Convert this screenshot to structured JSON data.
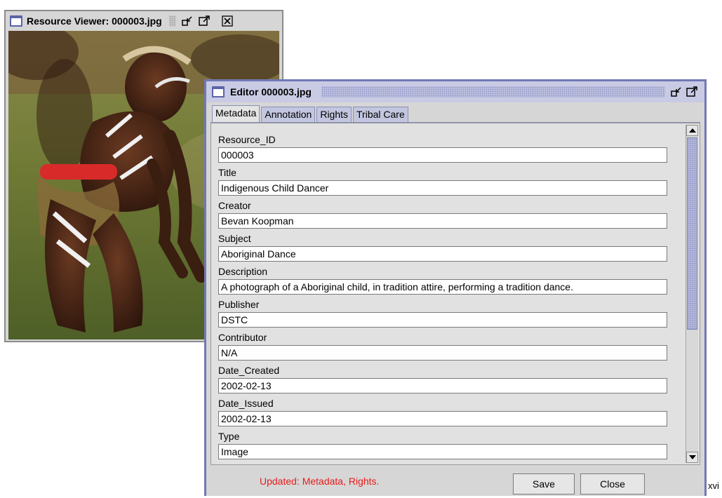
{
  "viewer": {
    "title": "Resource Viewer: 000003.jpg",
    "photo_alt": "Indigenous child dancer photograph"
  },
  "editor": {
    "title": "Editor 000003.jpg",
    "tabs": [
      "Metadata",
      "Annotation",
      "Rights",
      "Tribal Care"
    ],
    "active_tab": "Metadata",
    "fields": [
      {
        "label": "Resource_ID",
        "value": "000003"
      },
      {
        "label": "Title",
        "value": "Indigenous Child Dancer"
      },
      {
        "label": "Creator",
        "value": "Bevan Koopman"
      },
      {
        "label": "Subject",
        "value": "Aboriginal Dance"
      },
      {
        "label": "Description",
        "value": "A photograph of a Aboriginal child, in tradition attire, performing a tradition dance."
      },
      {
        "label": "Publisher",
        "value": "DSTC"
      },
      {
        "label": "Contributor",
        "value": "N/A"
      },
      {
        "label": "Date_Created",
        "value": "2002-02-13"
      },
      {
        "label": "Date_Issued",
        "value": "2002-02-13"
      },
      {
        "label": "Type",
        "value": "Image"
      }
    ],
    "status": "Updated: Metadata, Rights.",
    "save_label": "Save",
    "close_label": "Close",
    "status_color": "#e81b1b",
    "accent_color": "#7179b4"
  },
  "page_label": "xvi"
}
